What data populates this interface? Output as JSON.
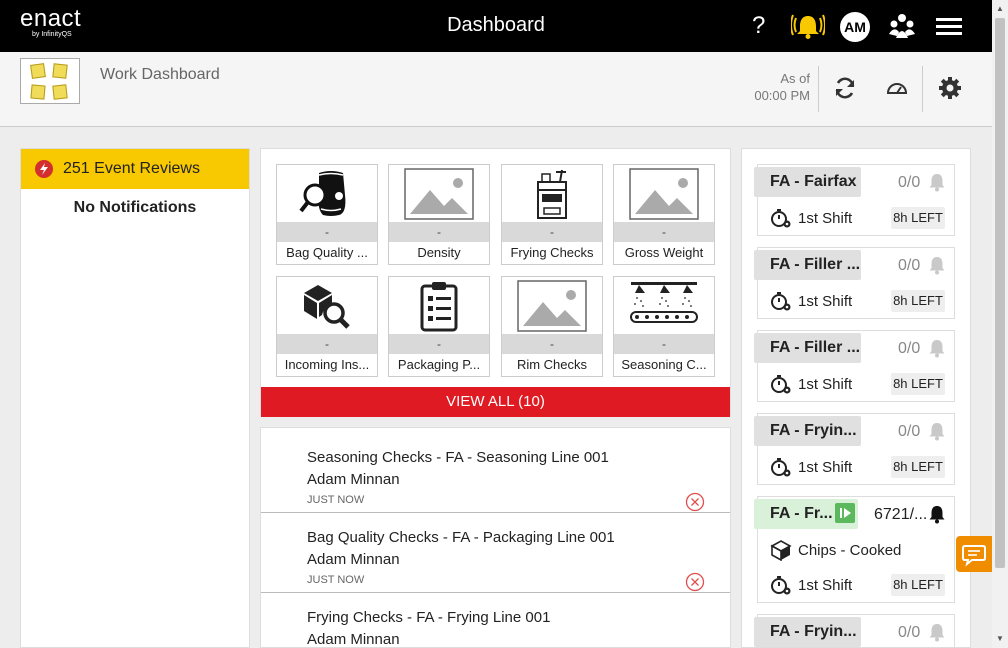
{
  "topbar": {
    "logo_main": "enact",
    "logo_sub": "by InfinityQS",
    "title": "Dashboard",
    "help_label": "?",
    "avatar_initials": "AM"
  },
  "header": {
    "title": "Work Dashboard",
    "as_of_label": "As of",
    "as_of_time": "00:00 PM"
  },
  "left": {
    "event_reviews": "251 Event Reviews",
    "no_notifications": "No Notifications"
  },
  "tiles": [
    {
      "label": "Bag Quality ...",
      "value": "-",
      "icon": "bag-magnifier-icon"
    },
    {
      "label": "Density",
      "value": "-",
      "icon": "image-placeholder-icon"
    },
    {
      "label": "Frying Checks",
      "value": "-",
      "icon": "fryer-icon"
    },
    {
      "label": "Gross Weight",
      "value": "-",
      "icon": "image-placeholder-icon"
    },
    {
      "label": "Incoming Ins...",
      "value": "-",
      "icon": "boxes-magnifier-icon"
    },
    {
      "label": "Packaging P...",
      "value": "-",
      "icon": "clipboard-checklist-icon"
    },
    {
      "label": "Rim Checks",
      "value": "-",
      "icon": "image-placeholder-icon"
    },
    {
      "label": "Seasoning C...",
      "value": "-",
      "icon": "seasoning-conveyor-icon"
    }
  ],
  "view_all": "VIEW ALL (10)",
  "activities": [
    {
      "title": "Seasoning Checks - FA - Seasoning Line 001",
      "user": "Adam Minnan",
      "time": "JUST NOW"
    },
    {
      "title": "Bag Quality Checks - FA - Packaging Line 001",
      "user": "Adam Minnan",
      "time": "JUST NOW"
    },
    {
      "title": "Frying Checks - FA - Frying Line 001",
      "user": "Adam Minnan",
      "time": ""
    }
  ],
  "cards": [
    {
      "name": "FA - Fairfax",
      "count": "0/0",
      "shift": "1st Shift",
      "left": "8h LEFT"
    },
    {
      "name": "FA - Filler ...",
      "count": "0/0",
      "shift": "1st Shift",
      "left": "8h LEFT"
    },
    {
      "name": "FA - Filler ...",
      "count": "0/0",
      "shift": "1st Shift",
      "left": "8h LEFT"
    },
    {
      "name": "FA - Fryin...",
      "count": "0/0",
      "shift": "1st Shift",
      "left": "8h LEFT"
    },
    {
      "name": "FA - Fr...",
      "count": "6721/...",
      "product": "Chips - Cooked",
      "shift": "1st Shift",
      "left": "8h LEFT",
      "status_color": "#5cb85c"
    },
    {
      "name": "FA - Fryin...",
      "count": "0/0"
    }
  ],
  "colors": {
    "accent_yellow": "#f8c800",
    "accent_red": "#e01a22",
    "running_green": "#5cb85c",
    "chat_orange": "#f08c00"
  }
}
